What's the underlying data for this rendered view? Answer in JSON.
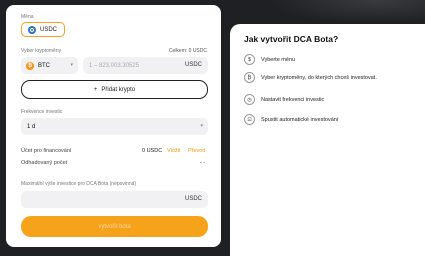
{
  "card": {
    "currency_label": "Měna",
    "currency_value": "USDC",
    "crypto_label": "Vyber kryptoměny",
    "total_label": "Celkem: 0 USDC",
    "crypto_select": "BTC",
    "amount_placeholder": "1 – 823,003.30525",
    "amount_unit": "USDC",
    "add_crypto": "Přidat krypto",
    "frequency_label": "Frekvence investic",
    "frequency_value": "1 d",
    "funding_account_label": "Účet pro financování",
    "funding_account_value": "0 USDC",
    "deposit_link": "Vložit",
    "transfer_link": "Převod",
    "countdown_label": "Odhadovaný počet",
    "countdown_value": "- -",
    "max_label": "Maximální výše investice pro DCA Bota (nepovinná)",
    "max_unit": "USDC",
    "create_button": "vytvořit bota"
  },
  "panel": {
    "title": "Jak vytvořit DCA Bota?",
    "steps": [
      {
        "icon": "currency-icon",
        "label": "Vyberte měnu"
      },
      {
        "icon": "crypto-icon",
        "label": "Vyber kryptoměny, do kterých chceš investovat."
      },
      {
        "icon": "clock-icon",
        "label": "Nastavit frekvenci investic"
      },
      {
        "icon": "lock-icon",
        "label": "Spustit automatické investování"
      }
    ]
  },
  "colors": {
    "accent": "#f6a21a",
    "link": "#f39c12",
    "input_bg": "#f1f1f3"
  }
}
